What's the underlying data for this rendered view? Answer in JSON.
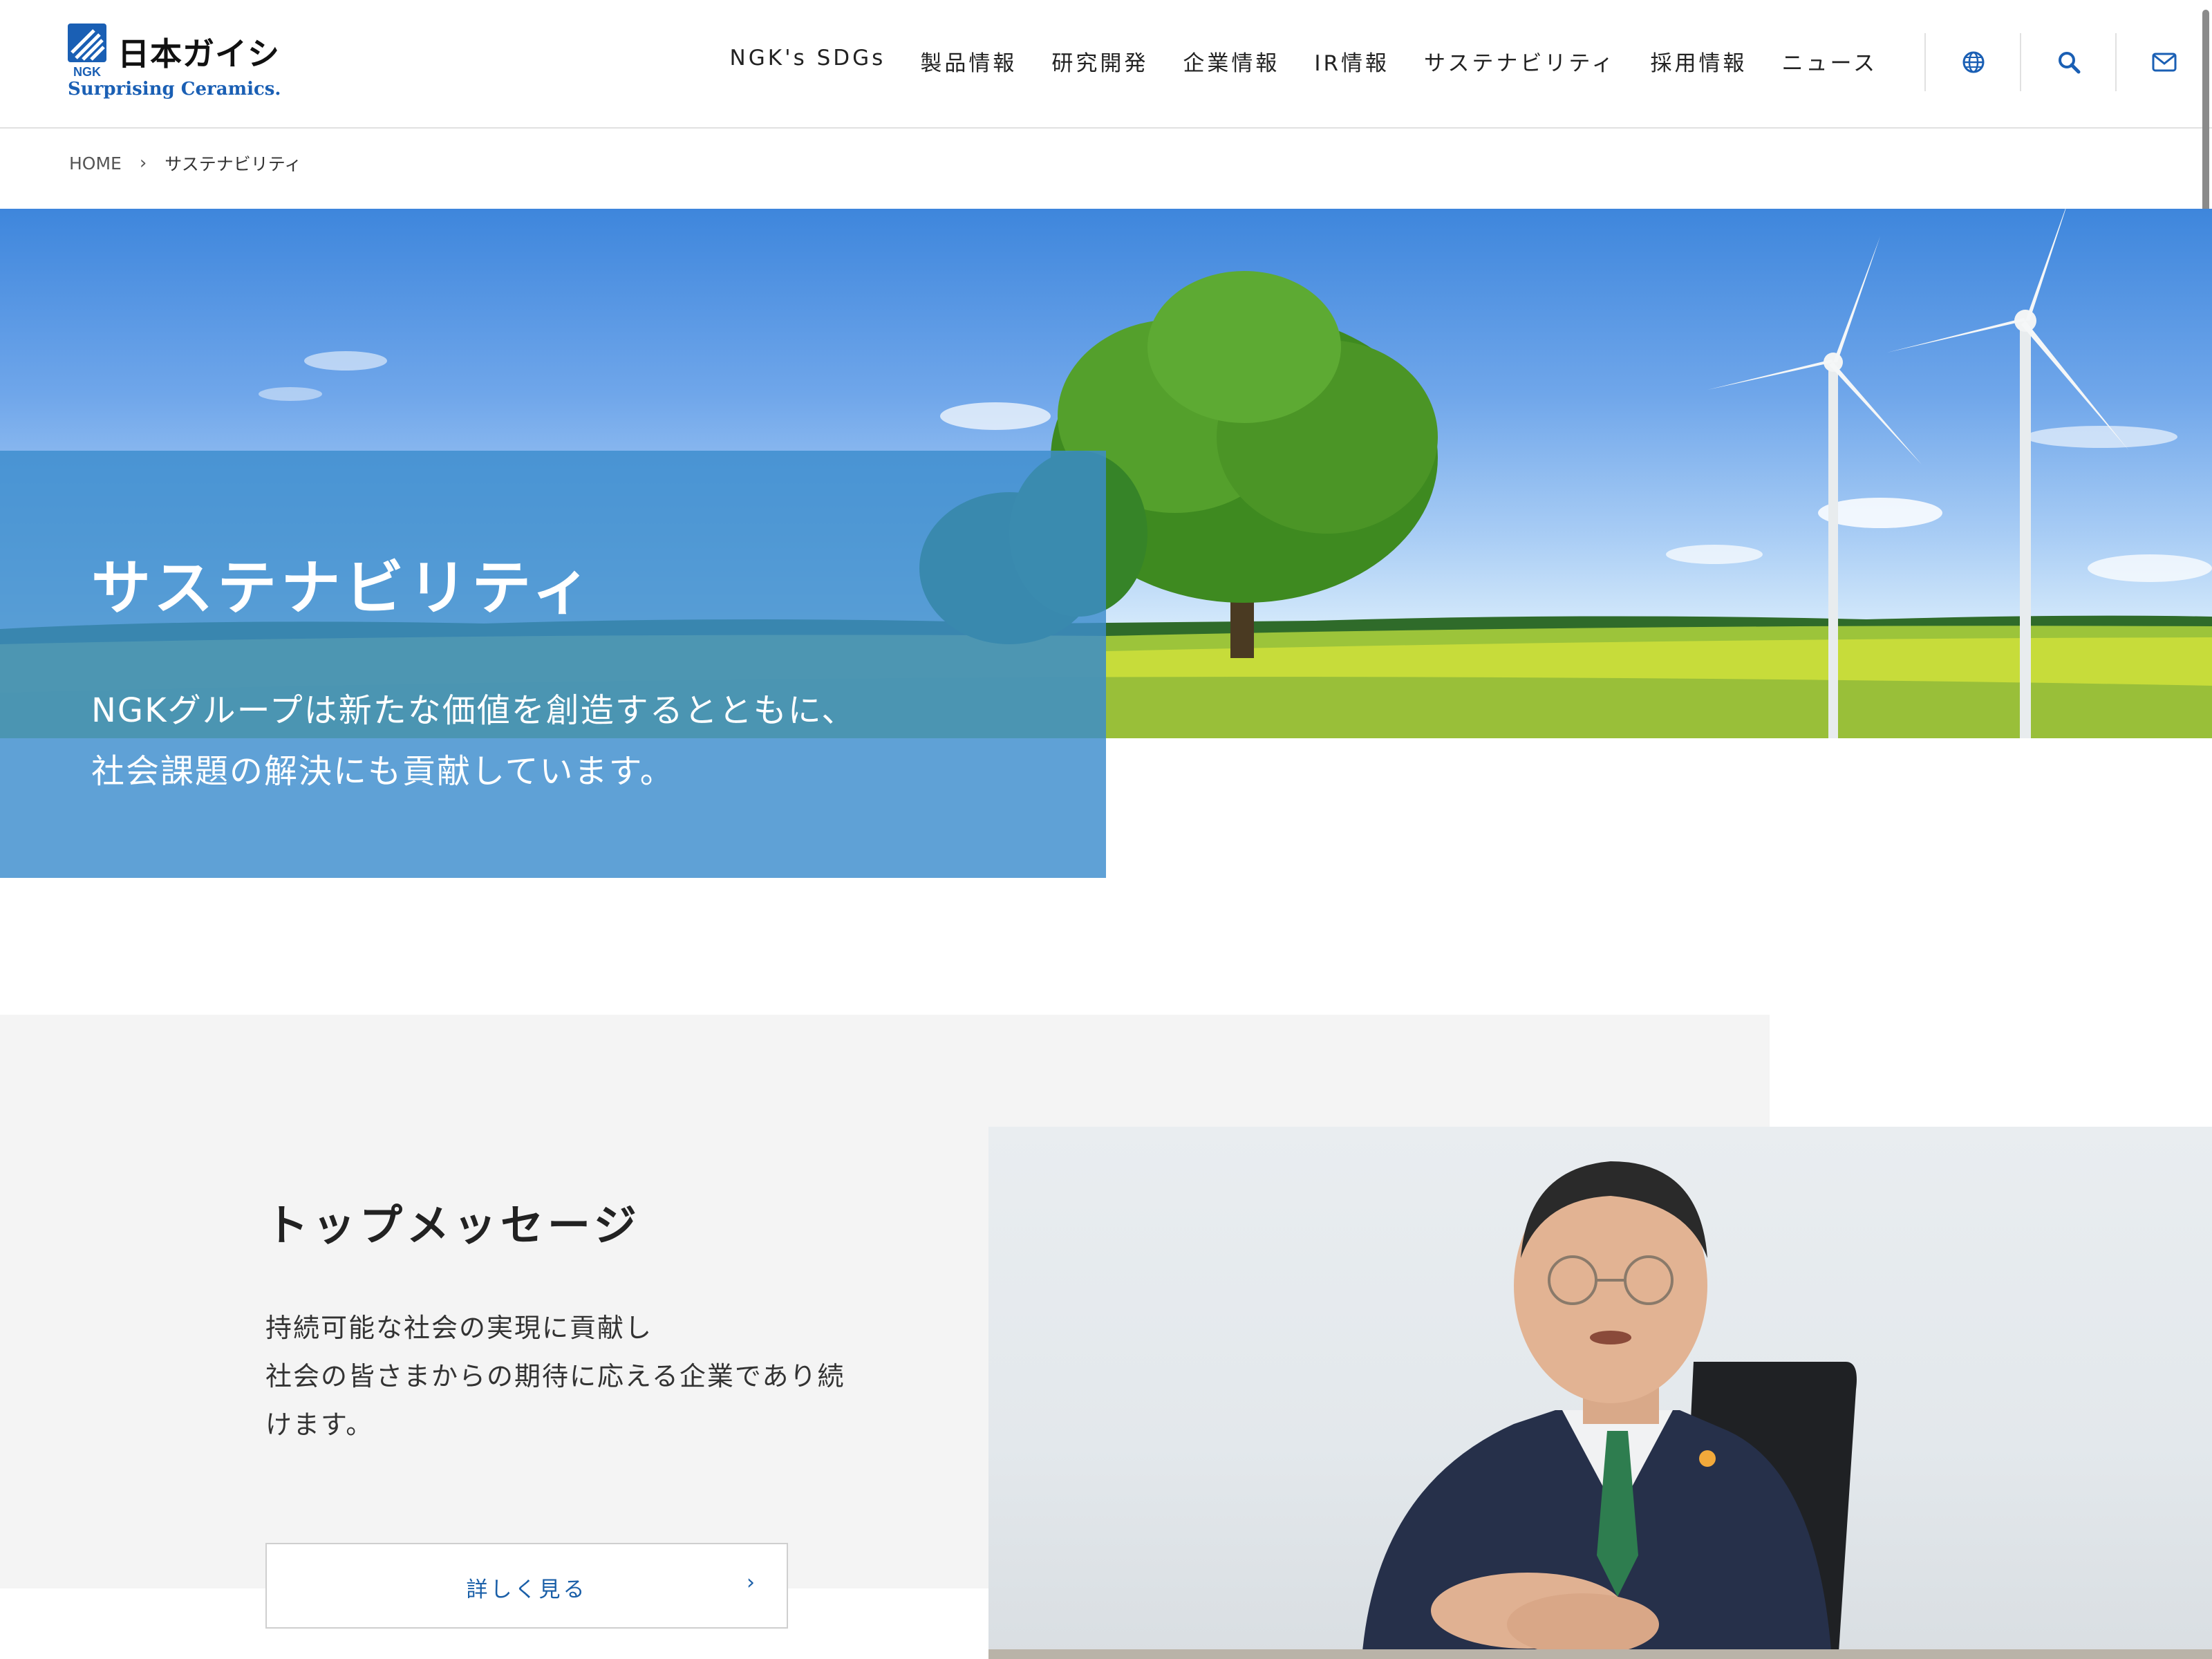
{
  "header": {
    "logo_jp": "日本ガイシ",
    "logo_en": "Surprising Ceramics.",
    "logo_mark_text": "NGK",
    "nav": [
      "NGK's SDGs",
      "製品情報",
      "研究開発",
      "企業情報",
      "IR情報",
      "サステナビリティ",
      "採用情報",
      "ニュース"
    ],
    "icons": [
      "globe-icon",
      "search-icon",
      "mail-icon"
    ]
  },
  "breadcrumb": {
    "home": "HOME",
    "separator": "›",
    "current": "サステナビリティ"
  },
  "hero": {
    "title": "サステナビリティ",
    "description": [
      "NGKグループは新たな価値を創造するとともに、",
      "社会課題の解決にも貢献しています。"
    ]
  },
  "top_message": {
    "title": "トップメッセージ",
    "body": [
      "持続可能な社会の実現に貢献し",
      "社会の皆さまからの期待に応える企業であり続",
      "けます。"
    ],
    "button_label": "詳しく見る",
    "button_arrow": "›"
  },
  "colors": {
    "brand_blue": "#1a5fb4",
    "panel_blue": "#3c8ccd",
    "link_blue": "#1a5fa8"
  }
}
